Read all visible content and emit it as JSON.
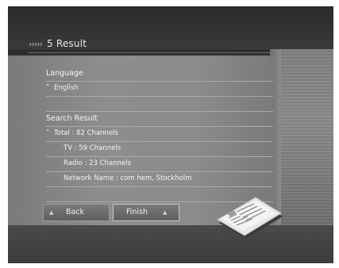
{
  "header": {
    "chevrons": "›››››",
    "title": "5 Result"
  },
  "language": {
    "label": "Language",
    "value": "English"
  },
  "search_result": {
    "label": "Search Result",
    "total": "Total : 82 Channels",
    "tv": "TV : 59 Channels",
    "radio": "Radio : 23 Channels",
    "network": "Network Name : com hem, Stockholm"
  },
  "buttons": {
    "back": "Back",
    "finish": "Finish"
  },
  "icons": {
    "bullet": "˄",
    "back_arrow": "▲",
    "finish_arrow": "▲"
  },
  "colors": {
    "panel": "#8c8c8c",
    "background": "#2f2f2f",
    "text": "#f4f4f4"
  }
}
